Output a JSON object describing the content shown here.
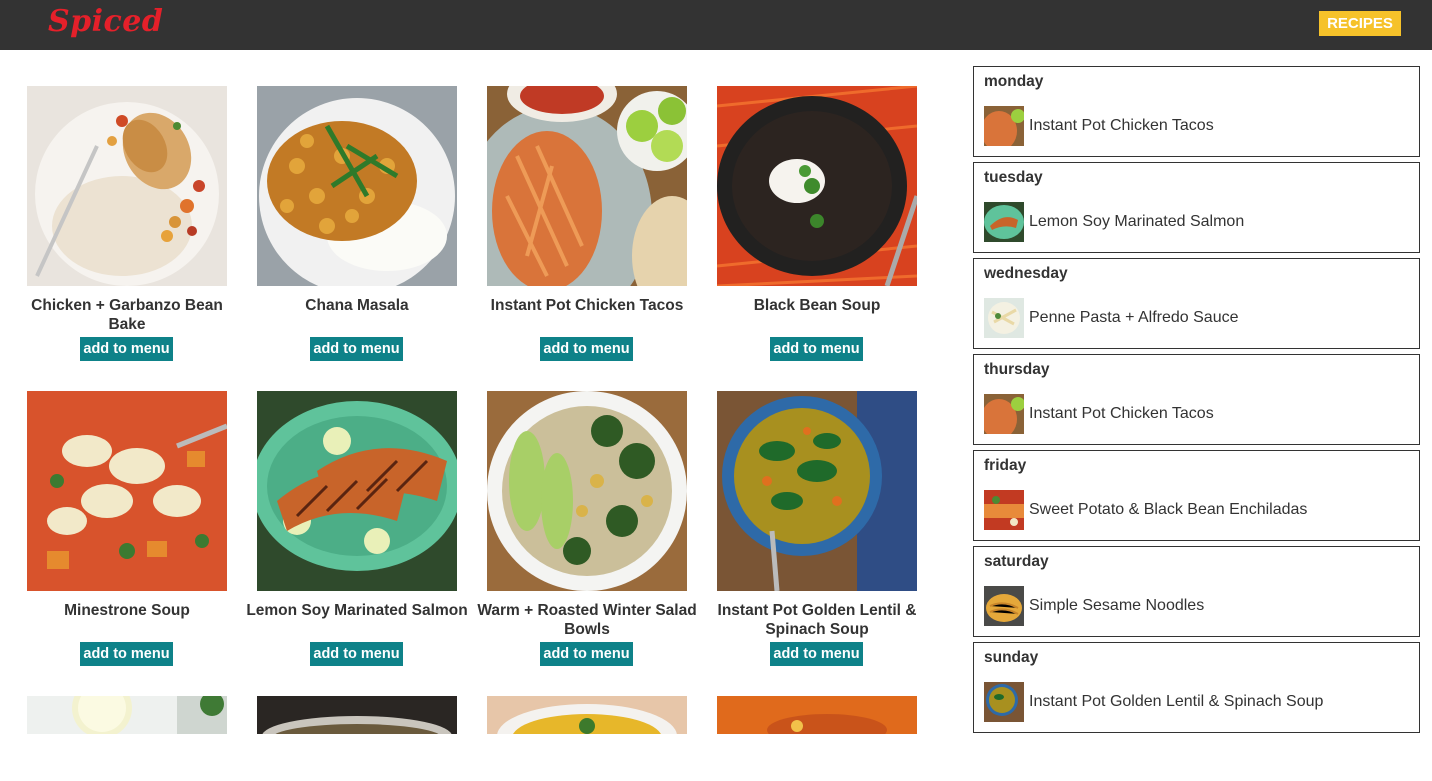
{
  "header": {
    "logo": "Spiced",
    "recipes_label": "RECIPES"
  },
  "recipes": [
    {
      "title": "Chicken + Garbanzo Bean Bake",
      "button": "add to menu"
    },
    {
      "title": "Chana Masala",
      "button": "add to menu"
    },
    {
      "title": "Instant Pot Chicken Tacos",
      "button": "add to menu"
    },
    {
      "title": "Black Bean Soup",
      "button": "add to menu"
    },
    {
      "title": "Minestrone Soup",
      "button": "add to menu"
    },
    {
      "title": "Lemon Soy Marinated Salmon",
      "button": "add to menu"
    },
    {
      "title": "Warm + Roasted Winter Salad Bowls",
      "button": "add to menu"
    },
    {
      "title": "Instant Pot Golden Lentil & Spinach Soup",
      "button": "add to menu"
    }
  ],
  "menu": [
    {
      "day": "monday",
      "recipe": "Instant Pot Chicken Tacos"
    },
    {
      "day": "tuesday",
      "recipe": "Lemon Soy Marinated Salmon"
    },
    {
      "day": "wednesday",
      "recipe": "Penne Pasta + Alfredo Sauce"
    },
    {
      "day": "thursday",
      "recipe": "Instant Pot Chicken Tacos"
    },
    {
      "day": "friday",
      "recipe": "Sweet Potato & Black Bean Enchiladas"
    },
    {
      "day": "saturday",
      "recipe": "Simple Sesame Noodles"
    },
    {
      "day": "sunday",
      "recipe": "Instant Pot Golden Lentil & Spinach Soup"
    }
  ],
  "colors": {
    "header_bg": "#333333",
    "logo": "#e5202a",
    "recipes_button": "#f6c22a",
    "add_button": "#0e8289"
  }
}
